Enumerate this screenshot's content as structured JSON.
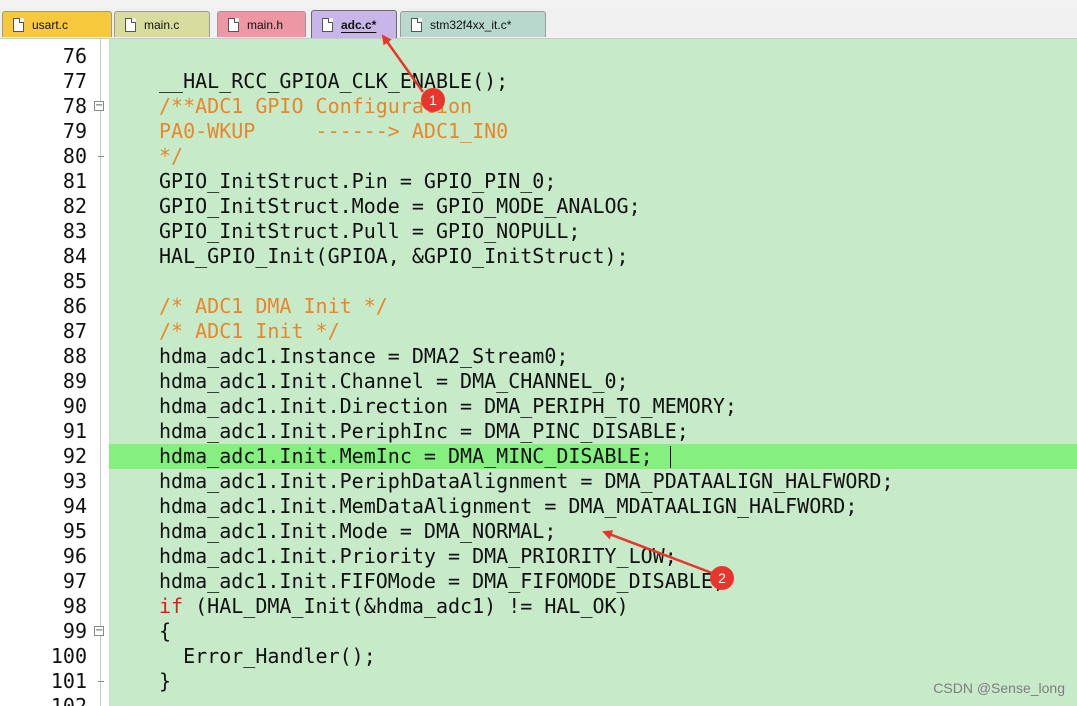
{
  "tabs": [
    {
      "label": "usart.c",
      "color": "#f8c93d",
      "active": false
    },
    {
      "label": "main.c",
      "color": "#d9dc9f",
      "active": false
    },
    {
      "label": "main.h",
      "color": "#ec97a3",
      "active": false
    },
    {
      "label": "adc.c*",
      "color": "#c9b6e8",
      "active": true
    },
    {
      "label": "stm32f4xx_it.c*",
      "color": "#b8d7cd",
      "active": false
    }
  ],
  "editor": {
    "current_line": 92,
    "lines": [
      {
        "num": "76",
        "text": ""
      },
      {
        "num": "77",
        "text": "__HAL_RCC_GPIOA_CLK_ENABLE();"
      },
      {
        "num": "78",
        "text": "/**ADC1 GPIO Configuration",
        "fold": "open"
      },
      {
        "num": "79",
        "text": "PA0-WKUP     ------> ADC1_IN0"
      },
      {
        "num": "80",
        "text": "*/",
        "fold": "end"
      },
      {
        "num": "81",
        "text": "GPIO_InitStruct.Pin = GPIO_PIN_0;"
      },
      {
        "num": "82",
        "text": "GPIO_InitStruct.Mode = GPIO_MODE_ANALOG;"
      },
      {
        "num": "83",
        "text": "GPIO_InitStruct.Pull = GPIO_NOPULL;"
      },
      {
        "num": "84",
        "text": "HAL_GPIO_Init(GPIOA, &GPIO_InitStruct);"
      },
      {
        "num": "85",
        "text": ""
      },
      {
        "num": "86",
        "text": "/* ADC1 DMA Init */"
      },
      {
        "num": "87",
        "text": "/* ADC1 Init */"
      },
      {
        "num": "88",
        "text": "hdma_adc1.Instance = DMA2_Stream0;"
      },
      {
        "num": "89",
        "text": "hdma_adc1.Init.Channel = DMA_CHANNEL_0;"
      },
      {
        "num": "90",
        "text": "hdma_adc1.Init.Direction = DMA_PERIPH_TO_MEMORY;"
      },
      {
        "num": "91",
        "text": "hdma_adc1.Init.PeriphInc = DMA_PINC_DISABLE;"
      },
      {
        "num": "92",
        "text": "hdma_adc1.Init.MemInc = DMA_MINC_DISABLE;"
      },
      {
        "num": "93",
        "text": "hdma_adc1.Init.PeriphDataAlignment = DMA_PDATAALIGN_HALFWORD;"
      },
      {
        "num": "94",
        "text": "hdma_adc1.Init.MemDataAlignment = DMA_MDATAALIGN_HALFWORD;"
      },
      {
        "num": "95",
        "text": "hdma_adc1.Init.Mode = DMA_NORMAL;"
      },
      {
        "num": "96",
        "text": "hdma_adc1.Init.Priority = DMA_PRIORITY_LOW;"
      },
      {
        "num": "97",
        "text": "hdma_adc1.Init.FIFOMode = DMA_FIFOMODE_DISABLE;"
      },
      {
        "num": "98",
        "text": "if (HAL_DMA_Init(&hdma_adc1) != HAL_OK)"
      },
      {
        "num": "99",
        "text": "{",
        "fold": "open"
      },
      {
        "num": "100",
        "text": "  Error_Handler();"
      },
      {
        "num": "101",
        "text": "}",
        "fold": "end"
      },
      {
        "num": "102",
        "text": ""
      }
    ]
  },
  "annotations": [
    {
      "label": "1"
    },
    {
      "label": "2"
    }
  ],
  "watermark": "CSDN @Sense_long",
  "colors": {
    "code_background": "#c7ebc9",
    "current_line": "#85f07f",
    "comment": "#e8862c",
    "keyword": "#d32020",
    "annotation": "#e8362f"
  }
}
